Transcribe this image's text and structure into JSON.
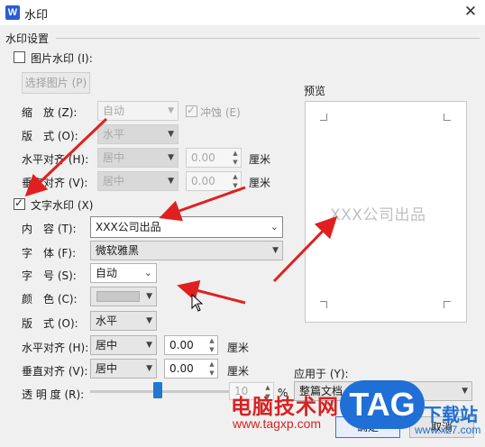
{
  "window": {
    "app_icon": "W",
    "title": "水印",
    "close_glyph": "✕"
  },
  "group_title": "水印设置",
  "picture": {
    "checkbox_label": "图片水印 (I):",
    "select_button": "选择图片 (P)",
    "scale_label": "缩　放 (Z):",
    "scale_value": "自动",
    "washout_label": "冲蚀 (E)",
    "layout_label": "版　式 (O):",
    "layout_value": "水平",
    "halign_label": "水平对齐 (H):",
    "halign_value": "居中",
    "halign_num": "0.00",
    "valign_label": "垂直对齐 (V):",
    "valign_value": "居中",
    "valign_num": "0.00",
    "unit": "厘米"
  },
  "text": {
    "checkbox_label": "文字水印 (X)",
    "content_label": "内　容 (T):",
    "content_value": "XXX公司出品",
    "font_label": "字　体 (F):",
    "font_value": "微软雅黑",
    "size_label": "字　号 (S):",
    "size_value": "自动",
    "color_label": "颜　色 (C):",
    "layout_label": "版　式 (O):",
    "layout_value": "水平",
    "halign_label": "水平对齐 (H):",
    "halign_value": "居中",
    "halign_num": "0.00",
    "valign_label": "垂直对齐 (V):",
    "valign_value": "居中",
    "valign_num": "0.00",
    "unit": "厘米",
    "transparency_label": "透 明 度 (R):",
    "transparency_value": "10",
    "transparency_unit": "%"
  },
  "preview": {
    "label": "预览",
    "watermark_text": "XXX公司出品"
  },
  "apply_to": {
    "label": "应用于 (Y):",
    "value": "整篇文档"
  },
  "buttons": {
    "ok": "确定",
    "cancel": "取消"
  },
  "overlay": {
    "site_name": "电脑技术网",
    "site_url": "www.tagxp.com",
    "logo": "TAG",
    "logo_suffix": "下载站",
    "logo_url": "www.xz7.com"
  },
  "colors": {
    "accent": "#1f78d1",
    "arrow": "#e02020",
    "watermark_brand": "#d72222"
  }
}
